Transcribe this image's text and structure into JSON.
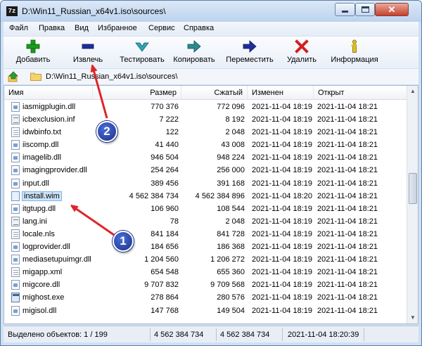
{
  "window": {
    "app_icon": "7z",
    "title": "D:\\Win11_Russian_x64v1.iso\\sources\\",
    "close_glyph": "✕"
  },
  "menu": [
    "Файл",
    "Правка",
    "Вид",
    "Избранное",
    "Сервис",
    "Справка"
  ],
  "toolbar": [
    {
      "label": "Добавить",
      "icon": "plus-icon",
      "color": "#1a9c1a"
    },
    {
      "label": "Извлечь",
      "icon": "minus-icon",
      "color": "#1e2f9c"
    },
    {
      "label": "Тестировать",
      "icon": "checkmark-chevron-icon",
      "color": "#2fa6b8"
    },
    {
      "label": "Копировать",
      "icon": "copy-arrow-icon",
      "color": "#2c8a8e"
    },
    {
      "label": "Переместить",
      "icon": "move-arrow-icon",
      "color": "#1e2f9c"
    },
    {
      "label": "Удалить",
      "icon": "delete-x-icon",
      "color": "#d42020"
    },
    {
      "label": "Информация",
      "icon": "info-icon",
      "color": "#e0c21a"
    }
  ],
  "address": {
    "path": "D:\\Win11_Russian_x64v1.iso\\sources\\"
  },
  "columns": {
    "name": "Имя",
    "size": "Размер",
    "packed": "Сжатый",
    "modified": "Изменен",
    "created": "Открыт"
  },
  "files": [
    {
      "name": "iasmigplugin.dll",
      "type": "dll",
      "size": "770 376",
      "packed": "772 096",
      "modified": "2021-11-04 18:19",
      "created": "2021-11-04 18:21"
    },
    {
      "name": "icbexclusion.inf",
      "type": "inf",
      "size": "7 222",
      "packed": "8 192",
      "modified": "2021-11-04 18:19",
      "created": "2021-11-04 18:21"
    },
    {
      "name": "idwbinfo.txt",
      "type": "txt",
      "size": "122",
      "packed": "2 048",
      "modified": "2021-11-04 18:19",
      "created": "2021-11-04 18:21"
    },
    {
      "name": "iiscomp.dll",
      "type": "dll",
      "size": "41 440",
      "packed": "43 008",
      "modified": "2021-11-04 18:19",
      "created": "2021-11-04 18:21"
    },
    {
      "name": "imagelib.dll",
      "type": "dll",
      "size": "946 504",
      "packed": "948 224",
      "modified": "2021-11-04 18:19",
      "created": "2021-11-04 18:21"
    },
    {
      "name": "imagingprovider.dll",
      "type": "dll",
      "size": "254 264",
      "packed": "256 000",
      "modified": "2021-11-04 18:19",
      "created": "2021-11-04 18:21"
    },
    {
      "name": "input.dll",
      "type": "dll",
      "size": "389 456",
      "packed": "391 168",
      "modified": "2021-11-04 18:19",
      "created": "2021-11-04 18:21"
    },
    {
      "name": "install.wim",
      "type": "wim",
      "size": "4 562 384 734",
      "packed": "4 562 384 896",
      "modified": "2021-11-04 18:20",
      "created": "2021-11-04 18:21",
      "selected": true
    },
    {
      "name": "itgtupg.dll",
      "type": "dll",
      "size": "106 960",
      "packed": "108 544",
      "modified": "2021-11-04 18:19",
      "created": "2021-11-04 18:21"
    },
    {
      "name": "lang.ini",
      "type": "ini",
      "size": "78",
      "packed": "2 048",
      "modified": "2021-11-04 18:19",
      "created": "2021-11-04 18:21"
    },
    {
      "name": "locale.nls",
      "type": "nls",
      "size": "841 184",
      "packed": "841 728",
      "modified": "2021-11-04 18:19",
      "created": "2021-11-04 18:21"
    },
    {
      "name": "logprovider.dll",
      "type": "dll",
      "size": "184 656",
      "packed": "186 368",
      "modified": "2021-11-04 18:19",
      "created": "2021-11-04 18:21"
    },
    {
      "name": "mediasetupuimgr.dll",
      "type": "dll",
      "size": "1 204 560",
      "packed": "1 206 272",
      "modified": "2021-11-04 18:19",
      "created": "2021-11-04 18:21"
    },
    {
      "name": "migapp.xml",
      "type": "xml",
      "size": "654 548",
      "packed": "655 360",
      "modified": "2021-11-04 18:19",
      "created": "2021-11-04 18:21"
    },
    {
      "name": "migcore.dll",
      "type": "dll",
      "size": "9 707 832",
      "packed": "9 709 568",
      "modified": "2021-11-04 18:19",
      "created": "2021-11-04 18:21"
    },
    {
      "name": "mighost.exe",
      "type": "exe",
      "size": "278 864",
      "packed": "280 576",
      "modified": "2021-11-04 18:19",
      "created": "2021-11-04 18:21"
    },
    {
      "name": "migisol.dll",
      "type": "dll",
      "size": "147 768",
      "packed": "149 504",
      "modified": "2021-11-04 18:19",
      "created": "2021-11-04 18:21"
    }
  ],
  "statusbar": {
    "selected": "Выделено объектов: 1 / 199",
    "size": "4 562 384 734",
    "packed": "4 562 384 734",
    "datetime": "2021-11-04 18:20:39"
  },
  "annotations": {
    "badge1": "1",
    "badge2": "2",
    "arrow_color": "#e0242a"
  }
}
